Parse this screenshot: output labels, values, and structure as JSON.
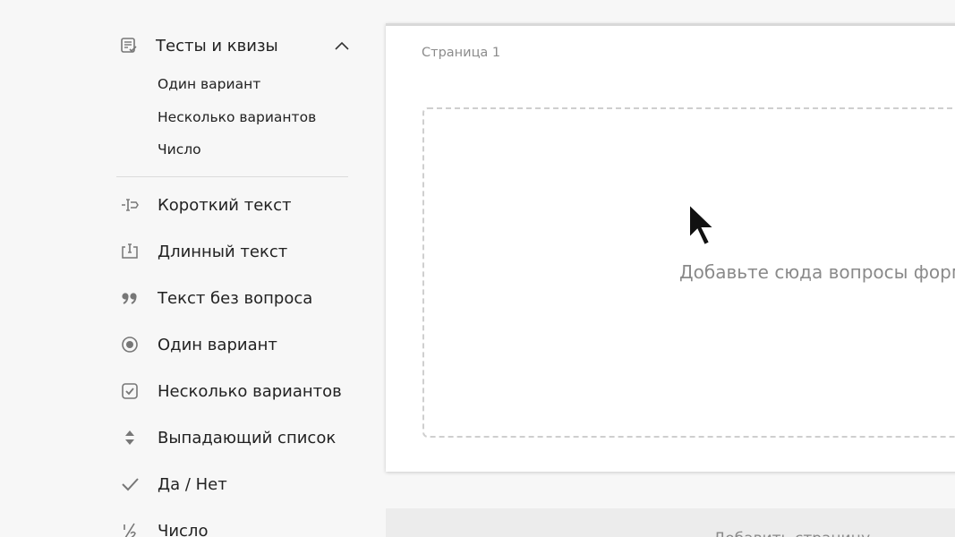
{
  "sidebar": {
    "group": {
      "label": "Тесты и квизы",
      "icon": "quiz-icon",
      "expanded": true,
      "subitems": [
        {
          "label": "Один вариант"
        },
        {
          "label": "Несколько вариантов"
        },
        {
          "label": "Число"
        }
      ]
    },
    "items": [
      {
        "label": "Короткий текст",
        "icon": "short-text-icon"
      },
      {
        "label": "Длинный текст",
        "icon": "long-text-icon"
      },
      {
        "label": "Текст без вопроса",
        "icon": "quote-icon"
      },
      {
        "label": "Один вариант",
        "icon": "radio-icon"
      },
      {
        "label": "Несколько вариантов",
        "icon": "checkbox-icon"
      },
      {
        "label": "Выпадающий список",
        "icon": "dropdown-icon"
      },
      {
        "label": "Да / Нет",
        "icon": "check-icon"
      },
      {
        "label": "Число",
        "icon": "fraction-icon"
      }
    ]
  },
  "main": {
    "page_label": "Страница 1",
    "dropzone_text": "Добавьте сюда вопросы формы",
    "add_page_label": "Добавить страницу"
  },
  "colors": {
    "background": "#f7f7f7",
    "card": "#ffffff",
    "muted_text": "#8a8a8a",
    "icon": "#777777"
  }
}
